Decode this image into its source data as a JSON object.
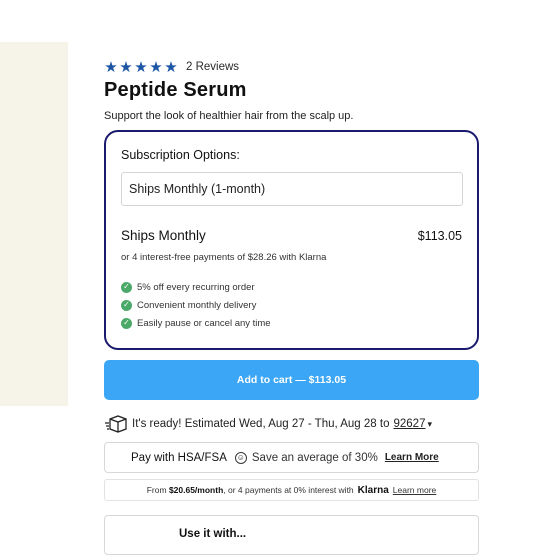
{
  "product": {
    "rating_stars": 5,
    "review_count": "2 Reviews",
    "title": "Peptide Serum",
    "subtitle": "Support the look of healthier hair from the scalp up."
  },
  "subscription": {
    "label": "Subscription Options:",
    "selected_option": "Ships Monthly (1-month)",
    "plan_name": "Ships Monthly",
    "plan_price": "$113.05",
    "klarna_line": "or 4 interest-free payments of $28.26 with Klarna",
    "benefits": [
      "5% off every recurring order",
      "Convenient monthly delivery",
      "Easily pause or cancel any time"
    ]
  },
  "cart": {
    "button_label": "Add to cart — $113.05"
  },
  "delivery": {
    "text": "It's ready! Estimated Wed, Aug 27 - Thu, Aug 28 to",
    "zip": "92627"
  },
  "hsa": {
    "title": "Pay with HSA/FSA",
    "save_text": "Save an average of 30%",
    "link": "Learn More"
  },
  "klarna_bar": {
    "prefix": "From",
    "amount": "$20.65/month",
    "middle": ", or 4 payments at 0% interest with",
    "logo": "Klarna",
    "link": "Learn more"
  },
  "use_with": {
    "title": "Use it with..."
  },
  "colors": {
    "star": "#1c55a5",
    "card_border": "#1a1a6e",
    "button": "#3aa6f5",
    "check": "#4aa868",
    "left_panel": "#f6f3e9"
  }
}
